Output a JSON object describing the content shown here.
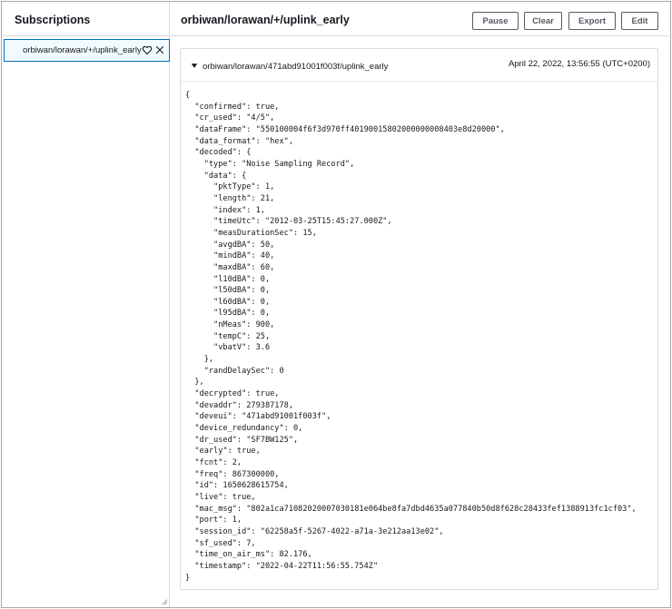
{
  "sidebar": {
    "title": "Subscriptions",
    "subscriptions": [
      {
        "topic": "orbiwan/lorawan/+/uplink_early",
        "favorite_icon": "heart-outline-icon",
        "remove_icon": "close-icon"
      }
    ]
  },
  "main": {
    "topic_title": "orbiwan/lorawan/+/uplink_early",
    "buttons": {
      "pause": "Pause",
      "clear": "Clear",
      "export": "Export",
      "edit": "Edit"
    },
    "message": {
      "expanded": true,
      "topic": "orbiwan/lorawan/471abd91001f003f/uplink_early",
      "timestamp": "April 22, 2022, 13:56:55 (UTC+0200)",
      "payload_lines": [
        "{",
        "  \"confirmed\": true,",
        "  \"cr_used\": \"4/5\",",
        "  \"dataFrame\": \"550100004f6f3d970ff40190015802000000008403e8d20000\",",
        "  \"data_format\": \"hex\",",
        "  \"decoded\": {",
        "    \"type\": \"Noise Sampling Record\",",
        "    \"data\": {",
        "      \"pktType\": 1,",
        "      \"length\": 21,",
        "      \"index\": 1,",
        "      \"timeUtc\": \"2012-03-25T15:45:27.000Z\",",
        "      \"measDurationSec\": 15,",
        "      \"avgdBA\": 50,",
        "      \"mindBA\": 40,",
        "      \"maxdBA\": 60,",
        "      \"l10dBA\": 0,",
        "      \"l50dBA\": 0,",
        "      \"l60dBA\": 0,",
        "      \"l95dBA\": 0,",
        "      \"nMeas\": 900,",
        "      \"tempC\": 25,",
        "      \"vbatV\": 3.6",
        "    },",
        "    \"randDelaySec\": 0",
        "  },",
        "  \"decrypted\": true,",
        "  \"devaddr\": 279387178,",
        "  \"deveui\": \"471abd91001f003f\",",
        "  \"device_redundancy\": 0,",
        "  \"dr_used\": \"SF7BW125\",",
        "  \"early\": true,",
        "  \"fcnt\": 2,",
        "  \"freq\": 867300000,",
        "  \"id\": 1650628615754,",
        "  \"live\": true,",
        "  \"mac_msg\": \"802a1ca71082020007030181e064be8fa7dbd4635a077840b50d8f628c28433fef1388913fc1cf03\",",
        "  \"port\": 1,",
        "  \"session_id\": \"62258a5f-5267-4022-a71a-3e212aa13e02\",",
        "  \"sf_used\": 7,",
        "  \"time_on_air_ms\": 82.176,",
        "  \"timestamp\": \"2022-04-22T11:56:55.754Z\"",
        "}"
      ]
    }
  },
  "colors": {
    "selected_border": "#0073bb",
    "selected_bg": "#f1faff",
    "button_border": "#545b64",
    "divider": "#d5dbdb"
  }
}
